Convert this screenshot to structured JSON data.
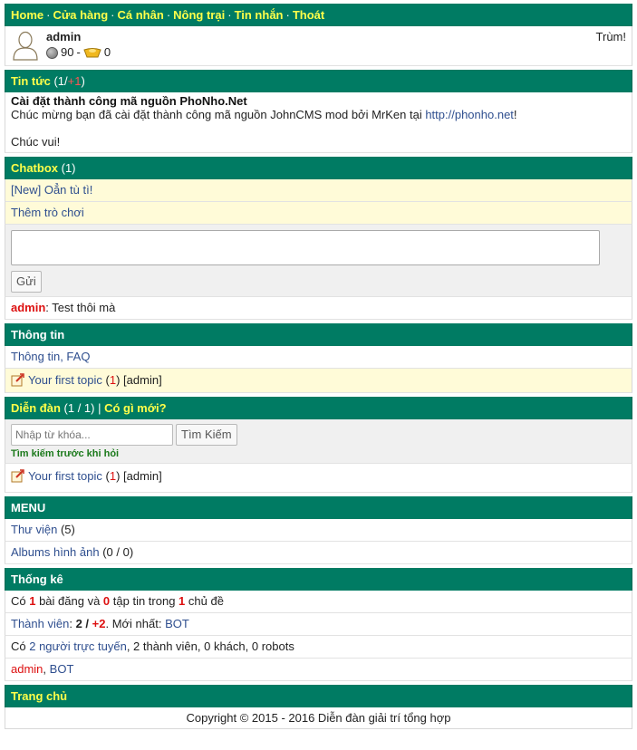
{
  "topnav": {
    "home": "Home",
    "shop": "Cửa hàng",
    "profile": "Cá nhân",
    "farm": "Nông trại",
    "messages": "Tin nhắn",
    "logout": "Thoát",
    "separator": "·"
  },
  "user": {
    "name": "admin",
    "coins": "90",
    "separator": "-",
    "gold": "0",
    "role": "Trùm!"
  },
  "news": {
    "title": "Tin tức",
    "count_open": " (1/",
    "count_new": "+1",
    "count_close": ")",
    "headline": "Cài đặt thành công mã nguồn PhoNho.Net",
    "body": "Chúc mừng bạn đã cài đặt thành công mã nguồn JohnCMS mod bởi MrKen tại ",
    "link": "http://phonho.net",
    "body_end": "!",
    "closing": "Chúc vui!"
  },
  "chatbox": {
    "title": "Chatbox",
    "count": " (1)",
    "items": [
      "[New] Oẳn tù tì!",
      "Thêm trò chơi"
    ],
    "send_label": "Gửi",
    "message_user": "admin",
    "message_text": ": Test thôi mà"
  },
  "info": {
    "title": "Thông tin",
    "link": "Thông tin, FAQ",
    "topic_title": "Your first topic",
    "topic_open": " (",
    "topic_count": "1",
    "topic_close": ")",
    "topic_author": " [admin]"
  },
  "forum": {
    "title": "Diễn đàn",
    "count": " (1 / 1) | ",
    "whats_new": "Có gì mới?",
    "search_placeholder": "Nhập từ khóa...",
    "search_button": "Tìm Kiếm",
    "hint": "Tìm kiếm trước khi hỏi",
    "topic_title": "Your first topic",
    "topic_open": " (",
    "topic_count": "1",
    "topic_close": ")",
    "topic_author": " [admin]"
  },
  "menu": {
    "title": "MENU",
    "library": "Thư viện",
    "library_count": " (5)",
    "albums": "Albums hình ảnh",
    "albums_count": " (0 / 0)"
  },
  "stats": {
    "title": "Thống kê",
    "l1_a": "Có ",
    "posts": "1",
    "l1_b": " bài đăng và ",
    "files": "0",
    "l1_c": " tập tin trong ",
    "threads": "1",
    "l1_d": " chủ đề",
    "members_label": "Thành viên",
    "members_sep": ": ",
    "members_count": "2",
    "members_slash": " / ",
    "members_new": "+2",
    "newest_label": ". Mới nhất: ",
    "newest": "BOT",
    "online_a": "Có ",
    "online_link": "2 người trực tuyến",
    "online_b": ", 2 thành viên, 0 khách, 0 robots",
    "online_user1": "admin",
    "online_comma": ", ",
    "online_user2": "BOT"
  },
  "footer": {
    "home": "Trang chủ",
    "copyright": "Copyright © 2015 - 2016 Diễn đàn giải trí tổng hợp"
  },
  "colors": {
    "header_bg": "#007b63",
    "header_link": "#ffff4a",
    "link": "#2f4f8f",
    "highlight_row": "#fffbd8",
    "red": "#dd1111"
  }
}
